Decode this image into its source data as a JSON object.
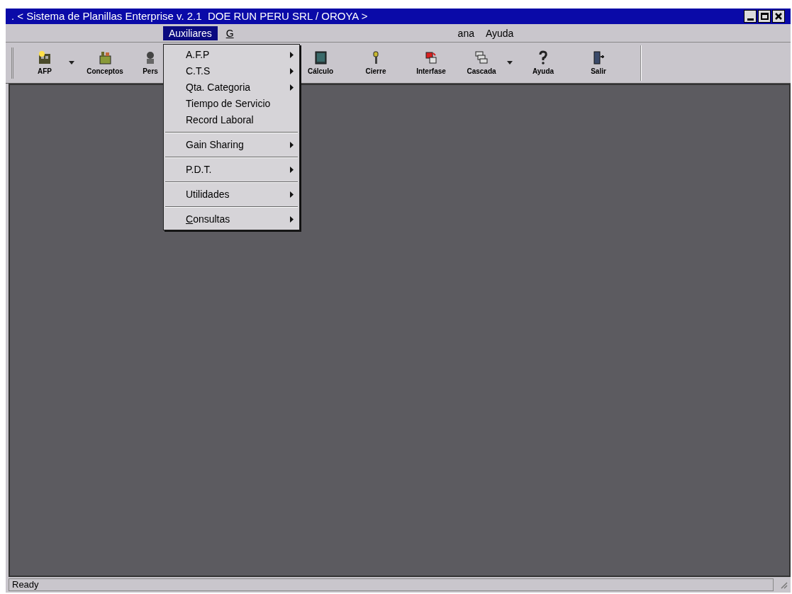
{
  "window": {
    "title": ". < Sistema de Planillas Enterprise v. 2.1  DOE RUN PERU SRL / OROYA >"
  },
  "menu_bar": [
    {
      "label": "Auxiliares",
      "selected": true,
      "underline_first": false
    },
    {
      "label": "G",
      "selected": false,
      "underline_first": true
    },
    {
      "label": "ana",
      "selected": false,
      "underline_first": false
    },
    {
      "label": "Ayuda",
      "selected": false,
      "underline_first": false
    }
  ],
  "toolbar": [
    {
      "label": "AFP",
      "dropdown": true
    },
    {
      "label": "Conceptos",
      "dropdown": false
    },
    {
      "label": "Pers",
      "dropdown": false
    },
    {
      "label": "Cálculo",
      "dropdown": false
    },
    {
      "label": "Cierre",
      "dropdown": false
    },
    {
      "label": "Interfase",
      "dropdown": false
    },
    {
      "label": "Cascada",
      "dropdown": true
    },
    {
      "label": "Ayuda",
      "dropdown": false
    },
    {
      "label": "Salir",
      "dropdown": false
    }
  ],
  "dropdown_menu": {
    "groups": [
      [
        {
          "label": "A.F.P",
          "submenu": true,
          "underline_first": false
        },
        {
          "label": "C.T.S",
          "submenu": true,
          "underline_first": false
        },
        {
          "label": "Qta. Categoria",
          "submenu": true,
          "underline_first": false
        },
        {
          "label": "Tiempo de Servicio",
          "submenu": false,
          "underline_first": false
        },
        {
          "label": "Record Laboral",
          "submenu": false,
          "underline_first": false
        }
      ],
      [
        {
          "label": "Gain Sharing",
          "submenu": true,
          "underline_first": false
        }
      ],
      [
        {
          "label": "P.D.T.",
          "submenu": true,
          "underline_first": false
        }
      ],
      [
        {
          "label": "Utilidades",
          "submenu": true,
          "underline_first": false
        }
      ],
      [
        {
          "label": "Consultas",
          "submenu": true,
          "underline_first": true
        }
      ]
    ]
  },
  "status_bar": {
    "text": "Ready"
  }
}
